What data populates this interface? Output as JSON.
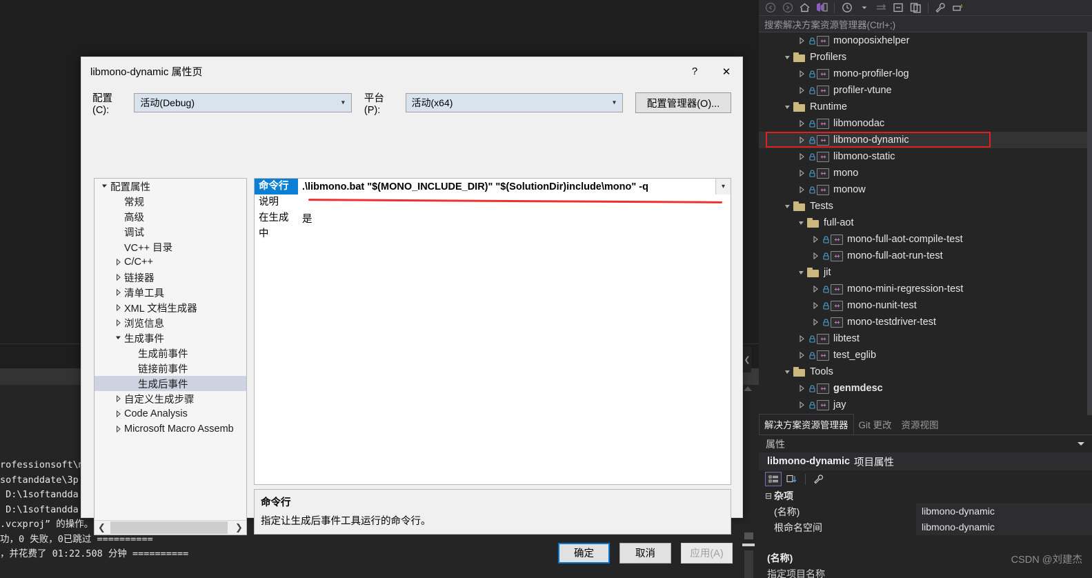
{
  "solution_explorer": {
    "search_placeholder": "搜索解决方案资源管理器(Ctrl+;)",
    "toolbar_icons": [
      "back-icon",
      "forward-icon",
      "home-icon",
      "vs-sync-icon",
      "pending-changes-icon",
      "chevron-down-icon",
      "show-all-files-icon",
      "collapse-all-icon",
      "new-window-icon",
      "properties-wrench-icon",
      "view-icon"
    ],
    "tree": [
      {
        "label": "monoposixhelper",
        "indent": 2,
        "type": "project",
        "arrow": "collapsed"
      },
      {
        "label": "Profilers",
        "indent": 1,
        "type": "folder",
        "arrow": "expanded"
      },
      {
        "label": "mono-profiler-log",
        "indent": 2,
        "type": "project",
        "arrow": "collapsed"
      },
      {
        "label": "profiler-vtune",
        "indent": 2,
        "type": "project",
        "arrow": "collapsed"
      },
      {
        "label": "Runtime",
        "indent": 1,
        "type": "folder",
        "arrow": "expanded"
      },
      {
        "label": "libmonodac",
        "indent": 2,
        "type": "project",
        "arrow": "collapsed"
      },
      {
        "label": "libmono-dynamic",
        "indent": 2,
        "type": "project",
        "arrow": "collapsed",
        "selected": true,
        "highlighted": true
      },
      {
        "label": "libmono-static",
        "indent": 2,
        "type": "project",
        "arrow": "collapsed"
      },
      {
        "label": "mono",
        "indent": 2,
        "type": "project",
        "arrow": "collapsed"
      },
      {
        "label": "monow",
        "indent": 2,
        "type": "project",
        "arrow": "collapsed"
      },
      {
        "label": "Tests",
        "indent": 1,
        "type": "folder",
        "arrow": "expanded"
      },
      {
        "label": "full-aot",
        "indent": 2,
        "type": "folder",
        "arrow": "expanded"
      },
      {
        "label": "mono-full-aot-compile-test",
        "indent": 3,
        "type": "project",
        "arrow": "collapsed"
      },
      {
        "label": "mono-full-aot-run-test",
        "indent": 3,
        "type": "project",
        "arrow": "collapsed"
      },
      {
        "label": "jit",
        "indent": 2,
        "type": "folder",
        "arrow": "expanded"
      },
      {
        "label": "mono-mini-regression-test",
        "indent": 3,
        "type": "project",
        "arrow": "collapsed"
      },
      {
        "label": "mono-nunit-test",
        "indent": 3,
        "type": "project",
        "arrow": "collapsed"
      },
      {
        "label": "mono-testdriver-test",
        "indent": 3,
        "type": "project",
        "arrow": "collapsed"
      },
      {
        "label": "libtest",
        "indent": 2,
        "type": "project",
        "arrow": "collapsed"
      },
      {
        "label": "test_eglib",
        "indent": 2,
        "type": "project",
        "arrow": "collapsed"
      },
      {
        "label": "Tools",
        "indent": 1,
        "type": "folder",
        "arrow": "expanded"
      },
      {
        "label": "genmdesc",
        "indent": 2,
        "type": "project",
        "arrow": "collapsed",
        "bold": true
      },
      {
        "label": "jay",
        "indent": 2,
        "type": "project",
        "arrow": "collapsed"
      }
    ],
    "tabs": [
      {
        "label": "解决方案资源管理器",
        "active": true
      },
      {
        "label": "Git 更改",
        "active": false
      },
      {
        "label": "资源视图",
        "active": false
      }
    ]
  },
  "properties_panel": {
    "title": "属性",
    "object_name": "libmono-dynamic",
    "object_suffix": "项目属性",
    "toolbar_icons": [
      "categorized-icon",
      "alphabetical-icon",
      "property-pages-wrench-icon"
    ],
    "category": "杂项",
    "rows": [
      {
        "key": "(名称)",
        "value": "libmono-dynamic"
      },
      {
        "key": "根命名空间",
        "value": "libmono-dynamic"
      }
    ],
    "desc_title": "(名称)",
    "desc_body": "指定项目名称"
  },
  "watermark": "CSDN @刘建杰",
  "output": {
    "lines": [
      "rofessionsoft\\m",
      "softanddate\\3p",
      " D:\\1softandda",
      " D:\\1softandda",
      ".vcxproj” 的操作。",
      "功，0 失败，0已跳过 ==========",
      "，并花费了 01:22.508 分钟 =========="
    ]
  },
  "dialog": {
    "title": "libmono-dynamic 属性页",
    "help_label": "?",
    "close_label": "✕",
    "config_label": "配置(C):",
    "config_value": "活动(Debug)",
    "platform_label": "平台(P):",
    "platform_value": "活动(x64)",
    "config_manager_label": "配置管理器(O)...",
    "tree": [
      {
        "label": "配置属性",
        "indent": 0,
        "arrow": "expanded"
      },
      {
        "label": "常规",
        "indent": 1,
        "arrow": "none"
      },
      {
        "label": "高级",
        "indent": 1,
        "arrow": "none"
      },
      {
        "label": "调试",
        "indent": 1,
        "arrow": "none"
      },
      {
        "label": "VC++ 目录",
        "indent": 1,
        "arrow": "none"
      },
      {
        "label": "C/C++",
        "indent": 1,
        "arrow": "collapsed"
      },
      {
        "label": "链接器",
        "indent": 1,
        "arrow": "collapsed"
      },
      {
        "label": "清单工具",
        "indent": 1,
        "arrow": "collapsed"
      },
      {
        "label": "XML 文档生成器",
        "indent": 1,
        "arrow": "collapsed"
      },
      {
        "label": "浏览信息",
        "indent": 1,
        "arrow": "collapsed"
      },
      {
        "label": "生成事件",
        "indent": 1,
        "arrow": "expanded"
      },
      {
        "label": "生成前事件",
        "indent": 2,
        "arrow": "none"
      },
      {
        "label": "链接前事件",
        "indent": 2,
        "arrow": "none"
      },
      {
        "label": "生成后事件",
        "indent": 2,
        "arrow": "none",
        "selected": true
      },
      {
        "label": "自定义生成步骤",
        "indent": 1,
        "arrow": "collapsed"
      },
      {
        "label": "Code Analysis",
        "indent": 1,
        "arrow": "collapsed"
      },
      {
        "label": "Microsoft Macro Assemb",
        "indent": 1,
        "arrow": "collapsed"
      }
    ],
    "grid": [
      {
        "key": "命令行",
        "value": ".\\libmono.bat \"$(MONO_INCLUDE_DIR)\" \"$(SolutionDir)include\\mono\" -q",
        "active": true,
        "has_dropdown": true
      },
      {
        "key": "说明",
        "value": "",
        "active": false,
        "has_dropdown": false
      },
      {
        "key": "在生成中",
        "value": "是",
        "active": false,
        "has_dropdown": false
      }
    ],
    "desc_title": "命令行",
    "desc_body": "指定让生成后事件工具运行的命令行。",
    "ok_label": "确定",
    "cancel_label": "取消",
    "apply_label": "应用(A)"
  }
}
